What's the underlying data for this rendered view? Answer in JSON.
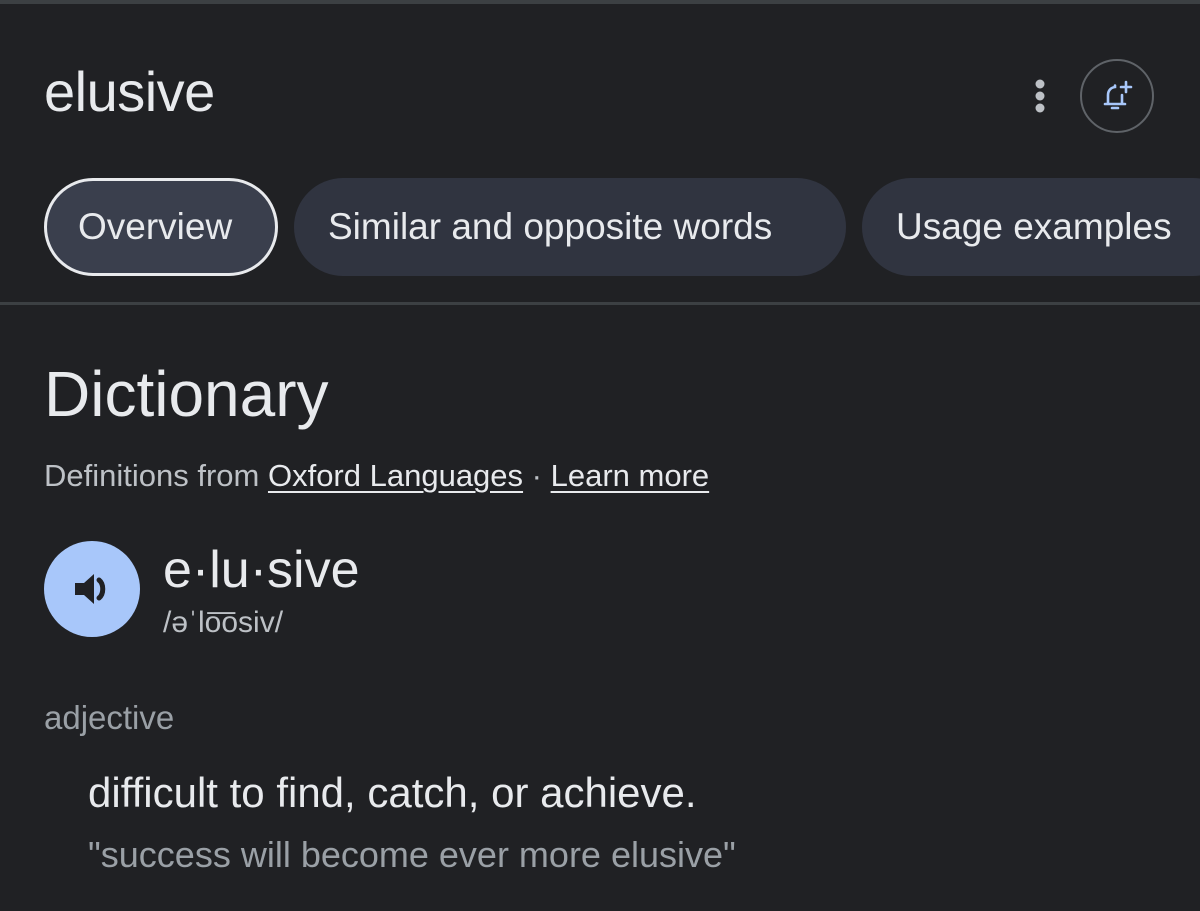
{
  "header": {
    "query": "elusive",
    "more_icon": "vertical-ellipsis-icon",
    "alert_icon": "bell-plus-icon"
  },
  "tabs": [
    {
      "label": "Overview",
      "active": true
    },
    {
      "label": "Similar and opposite words",
      "active": false
    },
    {
      "label": "Usage examples",
      "active": false
    }
  ],
  "dictionary": {
    "title": "Dictionary",
    "source_prefix": "Definitions from ",
    "source_link": "Oxford Languages",
    "separator": " · ",
    "learn_more": "Learn more",
    "speaker_icon": "speaker-icon",
    "headword": "e·lu·sive",
    "phonetic": "/əˈlo͞osiv/",
    "part_of_speech": "adjective",
    "definition": "difficult to find, catch, or achieve.",
    "example": "\"success will become ever more elusive\""
  },
  "colors": {
    "background": "#202124",
    "tab_background": "#303440",
    "speaker_accent": "#a8c7fa",
    "icon_accent": "#a8c7fa"
  }
}
